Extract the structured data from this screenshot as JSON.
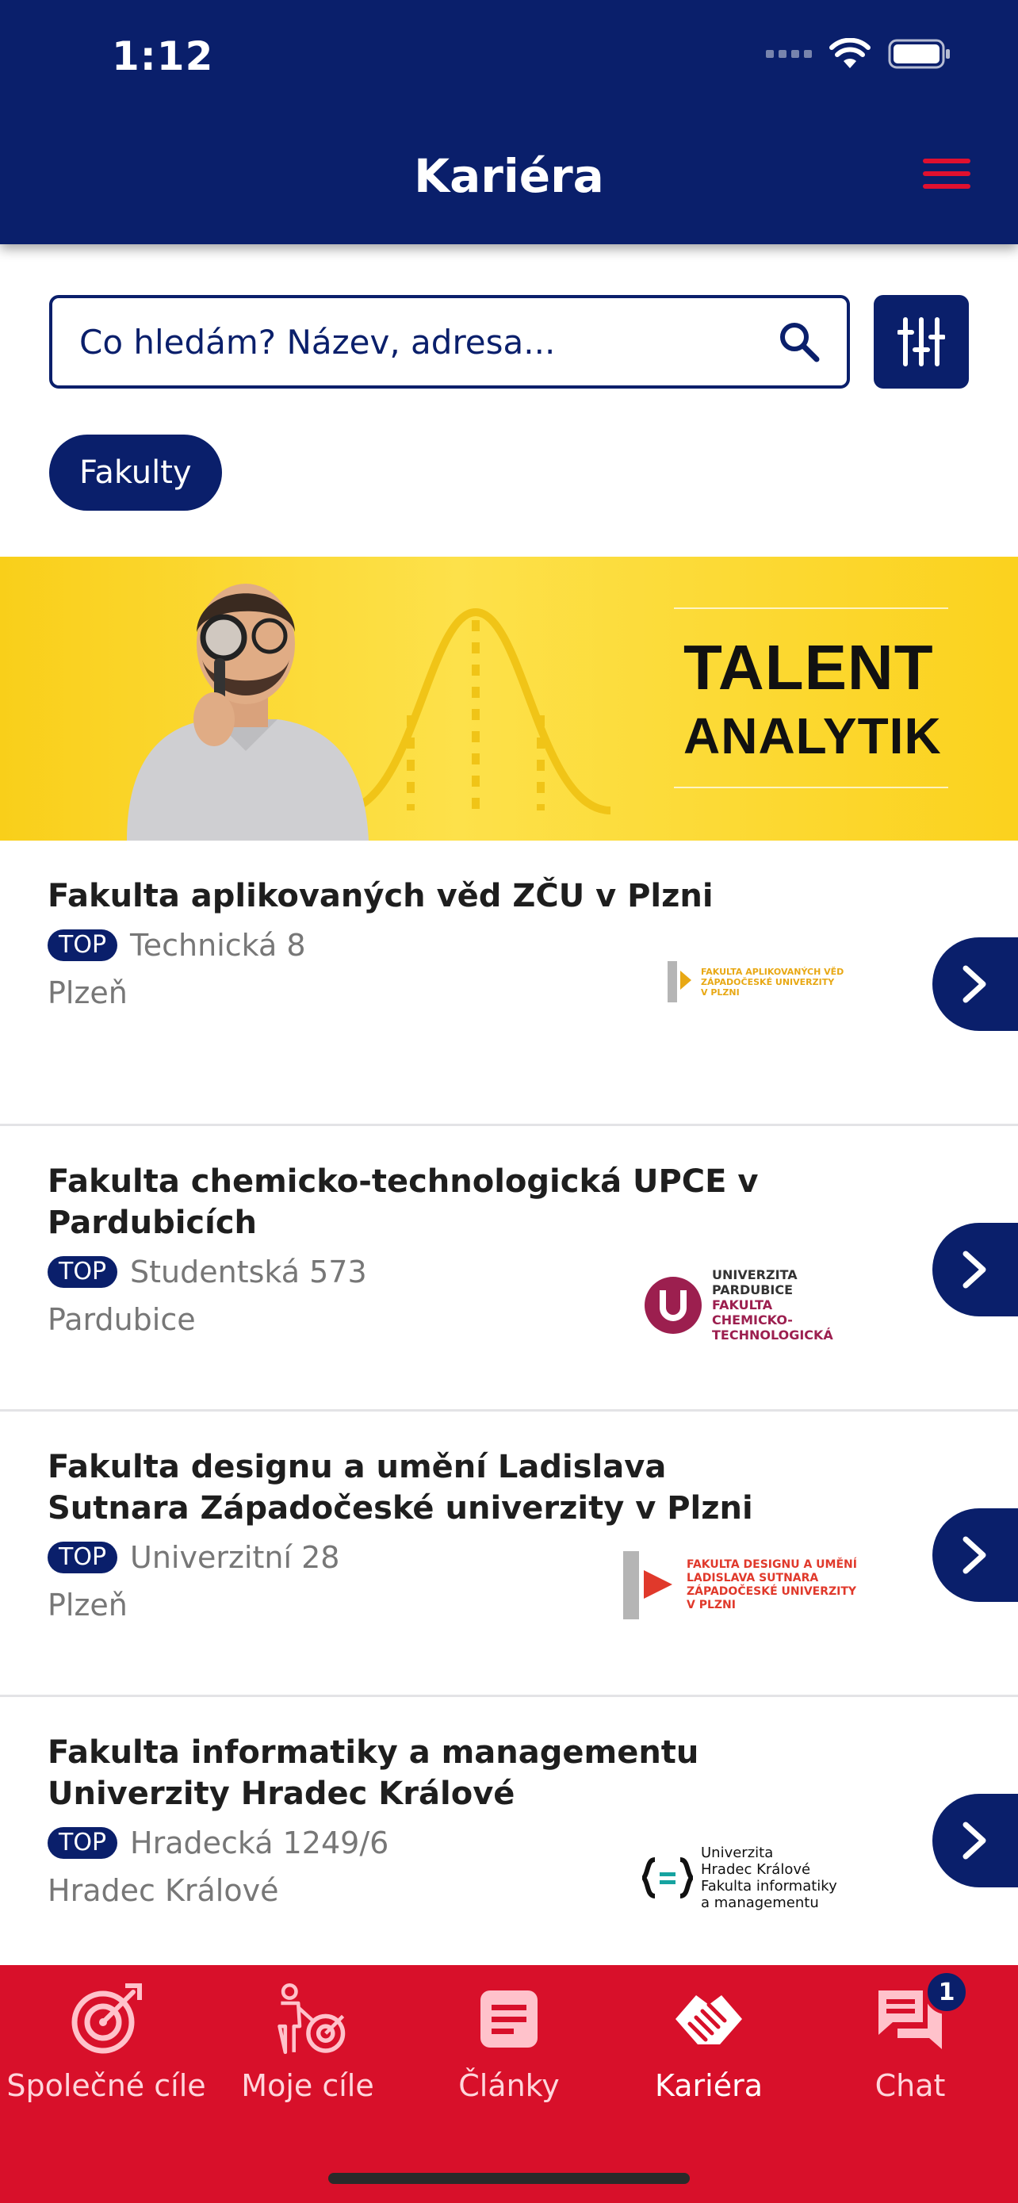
{
  "status_bar": {
    "time": "1:12"
  },
  "header": {
    "title": "Kariéra"
  },
  "search": {
    "placeholder": "Co hledám? Název, adresa..."
  },
  "chip": {
    "label": "Fakulty"
  },
  "banner": {
    "line1": "TALENT",
    "line2": "ANALYTIK"
  },
  "items": [
    {
      "title": "Fakulta aplikovaných věd ZČU v Plzni",
      "badge": "TOP",
      "street": "Technická 8",
      "city": "Plzeň",
      "logo_lines": [
        "FAKULTA APLIKOVANÝCH VĚD",
        "ZÁPADOČESKÉ UNIVERZITY",
        "V PLZNI"
      ]
    },
    {
      "title": "Fakulta chemicko-technologická UPCE v Pardubicích",
      "badge": "TOP",
      "street": "Studentská 573",
      "city": "Pardubice",
      "logo_lines": [
        "UNIVERZITA",
        "PARDUBICE",
        "FAKULTA",
        "CHEMICKO-",
        "TECHNOLOGICKÁ"
      ]
    },
    {
      "title": "Fakulta designu a umění Ladislava Sutnara Západočeské univerzity v Plzni",
      "badge": "TOP",
      "street": "Univerzitní 28",
      "city": "Plzeň",
      "logo_lines": [
        "FAKULTA DESIGNU A UMĚNÍ",
        "LADISLAVA SUTNARA",
        "ZÁPADOČESKÉ UNIVERZITY",
        "V PLZNI"
      ]
    },
    {
      "title": "Fakulta informatiky a managementu Univerzity Hradec Králové",
      "badge": "TOP",
      "street": "Hradecká 1249/6",
      "city": "Hradec Králové",
      "logo_lines": [
        "Univerzita",
        "Hradec Králové",
        "Fakulta informatiky",
        "a managementu"
      ]
    }
  ],
  "tabs": [
    {
      "label": "Společné cíle",
      "icon": "target-icon"
    },
    {
      "label": "Moje cíle",
      "icon": "person-target-icon"
    },
    {
      "label": "Články",
      "icon": "article-icon"
    },
    {
      "label": "Kariéra",
      "icon": "handshake-icon"
    },
    {
      "label": "Chat",
      "icon": "chat-icon",
      "badge": "1"
    }
  ],
  "colors": {
    "navy": "#0a1f6b",
    "red": "#d8102a",
    "banner_yellow": "#fbd21e"
  }
}
